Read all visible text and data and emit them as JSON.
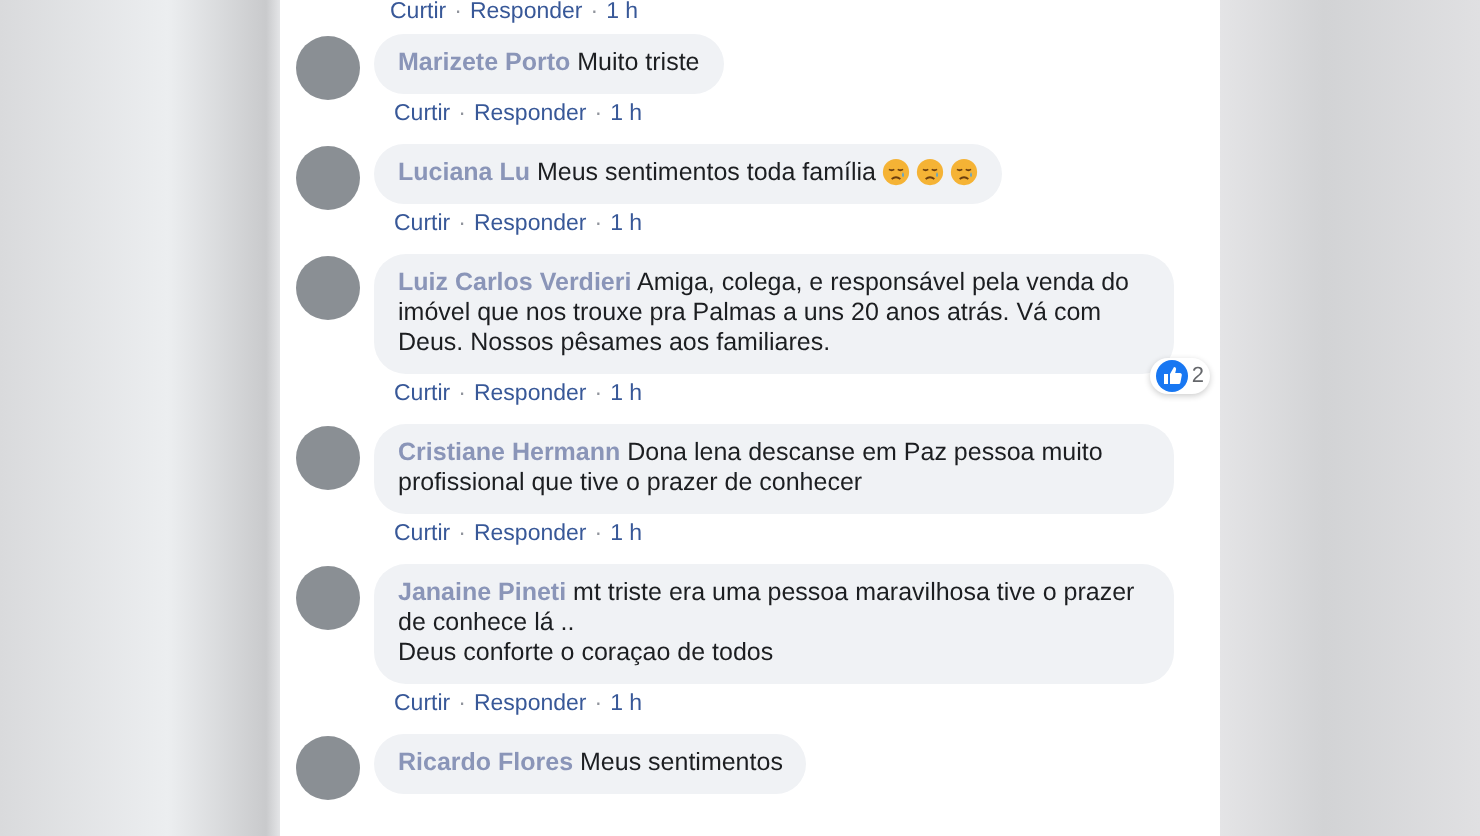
{
  "top_actions": {
    "like": "Curtir",
    "sep1": "·",
    "reply": "Responder",
    "sep2": "·",
    "time": "1 h"
  },
  "comments": [
    {
      "name": "Marizete Porto",
      "text": "Muito triste",
      "actions": {
        "like": "Curtir",
        "sep1": "·",
        "reply": "Responder",
        "sep2": "·",
        "time": "1 h"
      }
    },
    {
      "name": "Luciana Lu",
      "text": "Meus sentimentos toda família",
      "emojis": [
        {
          "kind": "sad"
        },
        {
          "kind": "sad"
        },
        {
          "kind": "sad"
        }
      ],
      "actions": {
        "like": "Curtir",
        "sep1": "·",
        "reply": "Responder",
        "sep2": "·",
        "time": "1 h"
      }
    },
    {
      "name": "Luiz Carlos Verdieri",
      "text": "Amiga, colega, e responsável pela venda do imóvel que nos trouxe pra Palmas a uns 20 anos atrás. Vá com Deus. Nossos pêsames aos familiares.",
      "reaction": {
        "count": "2"
      },
      "actions": {
        "like": "Curtir",
        "sep1": "·",
        "reply": "Responder",
        "sep2": "·",
        "time": "1 h"
      }
    },
    {
      "name": "Cristiane Hermann",
      "text": "Dona lena descanse em Paz pessoa muito profissional que tive o prazer de conhecer",
      "actions": {
        "like": "Curtir",
        "sep1": "·",
        "reply": "Responder",
        "sep2": "·",
        "time": "1 h"
      }
    },
    {
      "name": "Janaine Pineti",
      "text": "mt triste era uma pessoa maravilhosa tive o prazer de conhece lá ..\nDeus conforte o coraçao de todos",
      "actions": {
        "like": "Curtir",
        "sep1": "·",
        "reply": "Responder",
        "sep2": "·",
        "time": "1 h"
      }
    },
    {
      "name": "Ricardo Flores",
      "text": "Meus sentimentos"
    }
  ]
}
